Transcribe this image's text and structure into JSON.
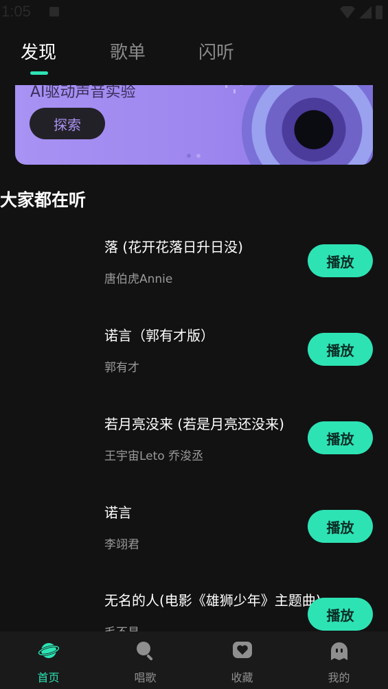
{
  "status_bar": {
    "time": "1:05"
  },
  "tabs": [
    {
      "label": "发现"
    },
    {
      "label": "歌单"
    },
    {
      "label": "闪听"
    }
  ],
  "banner": {
    "title": "AI驱动声音实验",
    "explore_label": "探索"
  },
  "section": {
    "title": "大家都在听"
  },
  "songs": [
    {
      "title": "落 (花开花落日升日没)",
      "artist": "唐伯虎Annie",
      "play_label": "播放"
    },
    {
      "title": "诺言（郭有才版）",
      "artist": "郭有才",
      "play_label": "播放"
    },
    {
      "title": "若月亮没来 (若是月亮还没来)",
      "artist": "王宇宙Leto 乔浚丞",
      "play_label": "播放"
    },
    {
      "title": "诺言",
      "artist": "李翊君",
      "play_label": "播放"
    },
    {
      "title": "无名的人(电影《雄狮少年》主题曲)",
      "artist": "毛不易",
      "play_label": "播放"
    }
  ],
  "bottom_nav": [
    {
      "label": "首页",
      "icon": "planet-icon"
    },
    {
      "label": "唱歌",
      "icon": "microphone-icon"
    },
    {
      "label": "收藏",
      "icon": "heart-box-icon"
    },
    {
      "label": "我的",
      "icon": "ghost-icon"
    }
  ],
  "colors": {
    "accent": "#2de3b4",
    "background": "#121212",
    "banner": "#9d86ee"
  }
}
